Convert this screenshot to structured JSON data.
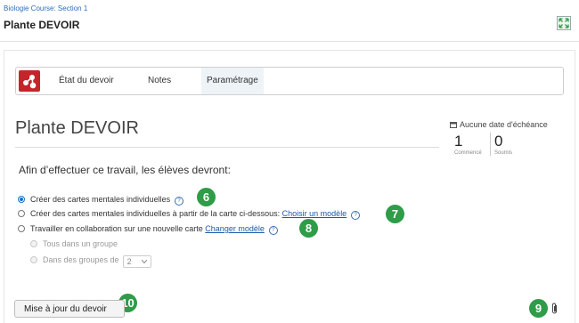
{
  "header": {
    "breadcrumb": "Biologie Course: Section 1",
    "title": "Plante DEVOIR",
    "expand_icon": "expand-icon"
  },
  "tabs": [
    {
      "label": "État du devoir",
      "active": false
    },
    {
      "label": "Notes",
      "active": false
    },
    {
      "label": "Paramétrage",
      "active": true
    }
  ],
  "logo_icon": "app-logo-icon",
  "assignment": {
    "title": "Plante DEVOIR",
    "due_label": "Aucune date d'échéance",
    "stats": [
      {
        "value": "1",
        "label": "Commencé"
      },
      {
        "value": "0",
        "label": "Soumis"
      }
    ]
  },
  "settings": {
    "instructions": "Afin d’effectuer ce travail, les élèves devront:",
    "options": [
      {
        "label": "Créer des cartes mentales individuelles",
        "checked": true
      },
      {
        "label": "Créer des cartes mentales individuelles à partir de la carte ci-dessous:",
        "link": "Choisir un modèle",
        "checked": false
      },
      {
        "label": "Travailler en collaboration sur une nouvelle carte",
        "link": "Changer modèle",
        "checked": false
      }
    ],
    "sub_options": [
      {
        "label": "Tous dans un groupe"
      },
      {
        "label": "Dans des groupes de",
        "select_value": "2"
      }
    ],
    "help_glyph": "?"
  },
  "callouts": [
    "6",
    "7",
    "8",
    "9",
    "10"
  ],
  "update_button": "Mise à jour du devoir",
  "attachment_icon": "paperclip-icon",
  "colors": {
    "accent": "#2e9c48",
    "logo": "#c6242b",
    "link": "#1a5aa5"
  }
}
